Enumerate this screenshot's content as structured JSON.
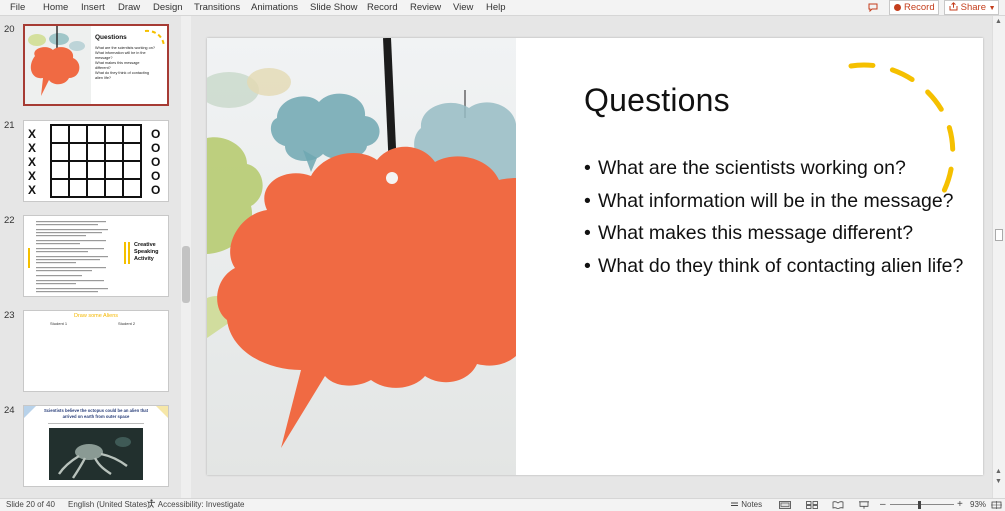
{
  "menu": [
    "File",
    "Home",
    "Insert",
    "Draw",
    "Design",
    "Transitions",
    "Animations",
    "Slide Show",
    "Record",
    "Review",
    "View",
    "Help"
  ],
  "header_buttons": {
    "record": "Record",
    "share": "Share"
  },
  "thumbnails": {
    "numbers": [
      "20",
      "21",
      "22",
      "23",
      "24"
    ],
    "t20": {
      "title": "Questions",
      "bullets": [
        "What are the scientists working on?",
        "What information will be in the message?",
        "What makes this message different?",
        "What do they think of contacting alien life?"
      ]
    },
    "t21": {
      "left": [
        "X",
        "X",
        "X",
        "X",
        "X"
      ],
      "right": [
        "O",
        "O",
        "O",
        "O",
        "O"
      ]
    },
    "t22": {
      "title_lines": [
        "Creative",
        "Speaking",
        "Activity"
      ]
    },
    "t23": {
      "title": "Draw some Aliens",
      "student1": "Student 1",
      "student2": "Student 2"
    },
    "t24": {
      "title": "Scientists believe the octopus could be an alien that arrived on earth from outer space"
    }
  },
  "slide": {
    "title": "Questions",
    "bullets": [
      "What are the scientists working on?",
      "What information will be in the message?",
      "What makes this message different?",
      "What do they think of contacting alien life?"
    ]
  },
  "status": {
    "slide": "Slide 20 of 40",
    "language": "English (United States)",
    "accessibility": "Accessibility: Investigate",
    "notes": "Notes",
    "zoom_minus": "–",
    "zoom_plus": "+",
    "zoom": "93%"
  },
  "colors": {
    "accent": "#c43e1c",
    "bubble": "#f06a43",
    "dashes": "#f5c000",
    "selected_border": "#a63b34"
  },
  "icons": [
    "comment-icon",
    "record-dot-icon",
    "share-icon",
    "accessibility-icon",
    "notes-icon",
    "normal-view-icon",
    "slide-sorter-icon",
    "reading-view-icon",
    "slideshow-icon",
    "fit-slide-icon"
  ]
}
